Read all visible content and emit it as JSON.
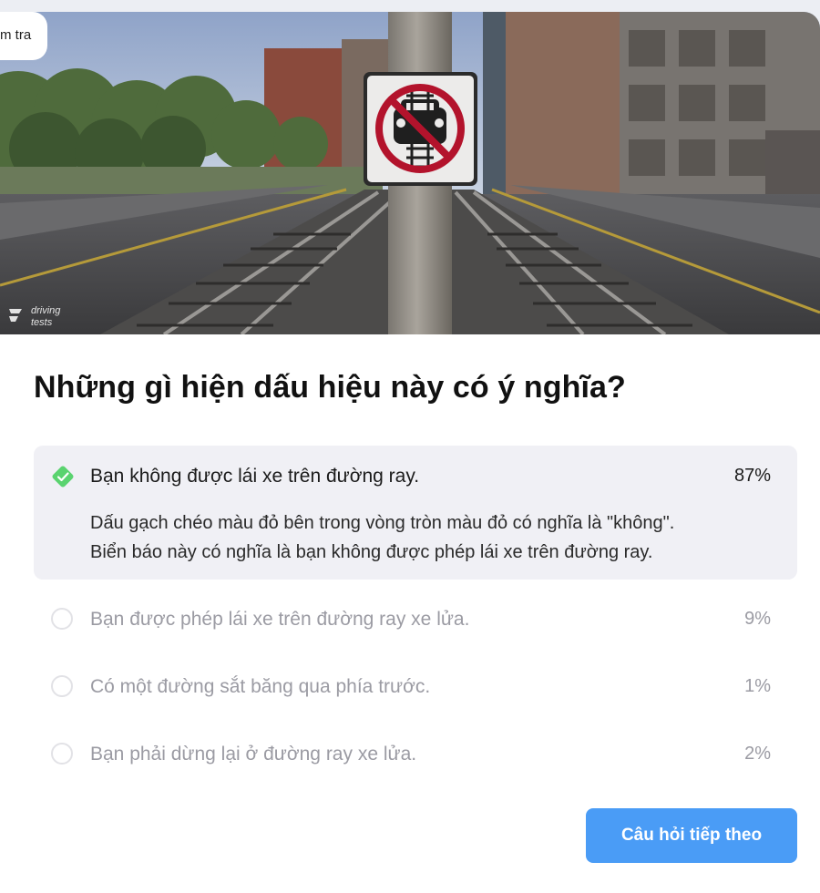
{
  "colors": {
    "accent": "#4a9cf6",
    "correct": "#5ad36f",
    "correct_bg": "#f0f0f5",
    "muted_text": "#9b9ba3",
    "sign_red": "#b3132c"
  },
  "header": {
    "tab_fragment": "m tra"
  },
  "image": {
    "subject": "no driving on railway tracks sign on pole beside train tracks",
    "watermark_lines": [
      "driving",
      "tests"
    ]
  },
  "question": {
    "text": "Những gì hiện dấu hiệu này có ý nghĩa?"
  },
  "answers": [
    {
      "label": "Bạn không được lái xe trên đường ray.",
      "percent": "87%",
      "correct": true,
      "explanation_line1": "Dấu gạch chéo màu đỏ bên trong vòng tròn màu đỏ có nghĩa là \"không\".",
      "explanation_line2": "Biển báo này có nghĩa là bạn không được phép lái xe trên đường ray.",
      "icon": "check-diamond-icon"
    },
    {
      "label": "Bạn được phép lái xe trên đường ray xe lửa.",
      "percent": "9%",
      "correct": false
    },
    {
      "label": "Có một đường sắt băng qua phía trước.",
      "percent": "1%",
      "correct": false
    },
    {
      "label": "Bạn phải dừng lại ở đường ray xe lửa.",
      "percent": "2%",
      "correct": false
    }
  ],
  "footer": {
    "next_label": "Câu hỏi tiếp theo"
  }
}
